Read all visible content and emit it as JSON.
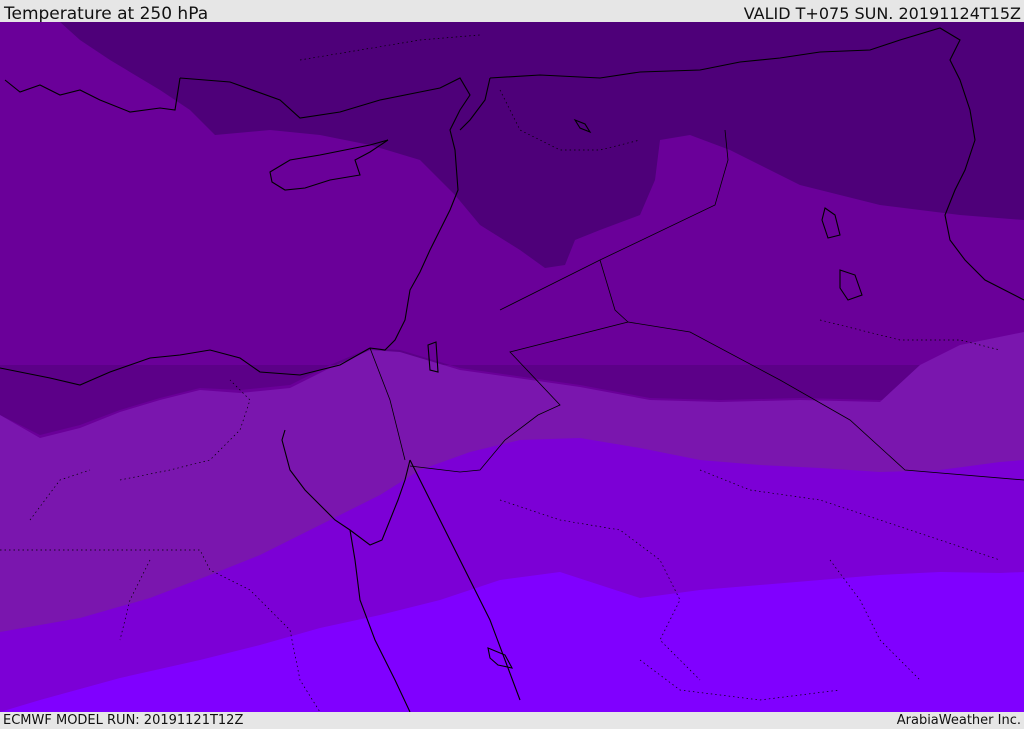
{
  "header": {
    "title": "Temperature at 250 hPa",
    "valid_time": "VALID T+075 SUN. 20191124T15Z"
  },
  "footer": {
    "model_run": "ECMWF MODEL RUN: 20191121T12Z",
    "credit": "ArabiaWeather Inc."
  },
  "map": {
    "field": "temperature_250hPa",
    "shading_colors": [
      "#4e0079",
      "#5c0088",
      "#6a0099",
      "#7a16ae",
      "#7c00d6",
      "#8000ff"
    ],
    "coastline_color": "#000000",
    "border_style": "dotted"
  }
}
